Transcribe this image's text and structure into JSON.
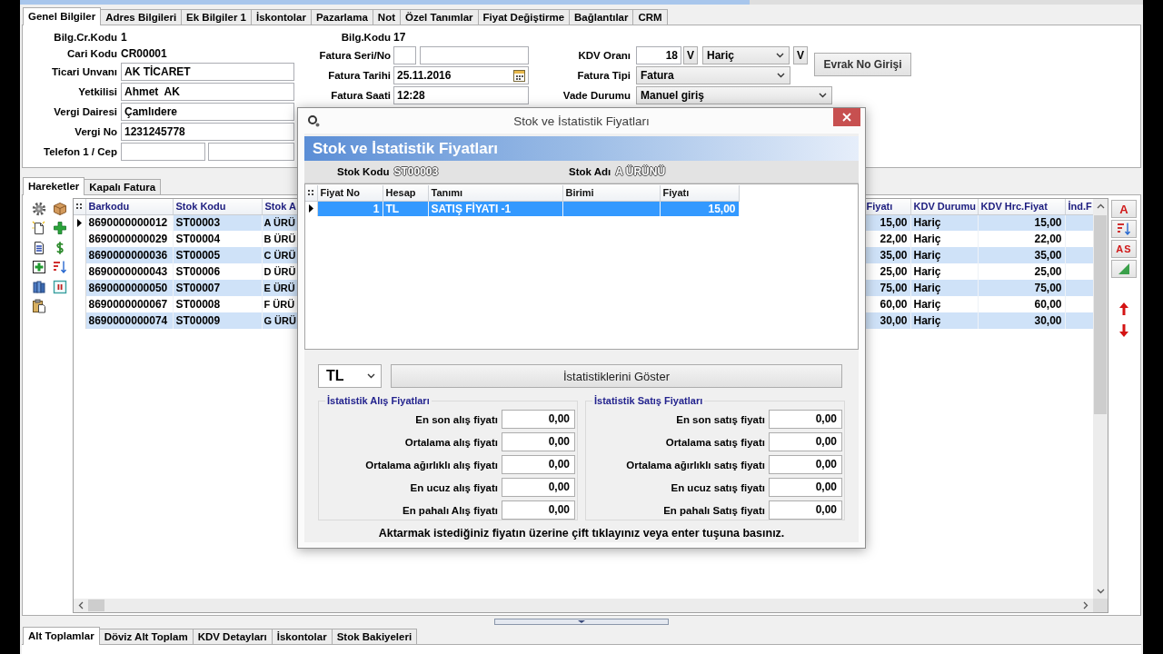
{
  "form_tabs": [
    {
      "label": "Genel Bilgiler",
      "selected": true
    },
    {
      "label": "Adres Bilgileri",
      "selected": false
    },
    {
      "label": "Ek Bilgiler 1",
      "selected": false
    },
    {
      "label": "İskontolar",
      "selected": false
    },
    {
      "label": "Pazarlama",
      "selected": false
    },
    {
      "label": "Not",
      "selected": false
    },
    {
      "label": "Özel Tanımlar",
      "selected": false
    },
    {
      "label": "Fiyat Değiştirme",
      "selected": false
    },
    {
      "label": "Bağlantılar",
      "selected": false
    },
    {
      "label": "CRM",
      "selected": false
    }
  ],
  "customer": [
    {
      "kind": "text",
      "label": "Bilg.Cr.Kodu",
      "value": "1"
    },
    {
      "kind": "text",
      "label": "Cari Kodu",
      "value": "CR00001"
    },
    {
      "kind": "input",
      "label": "Ticari Unvanı",
      "value": "AK TİCARET"
    },
    {
      "kind": "input",
      "label": "Yetkilisi",
      "value": "Ahmet  AK"
    },
    {
      "kind": "input",
      "label": "Vergi Dairesi",
      "value": "Çamlıdere"
    },
    {
      "kind": "input",
      "label": "Vergi No",
      "value": "1231245778"
    },
    {
      "kind": "pair",
      "label": "Telefon 1 / Cep"
    }
  ],
  "invoice": [
    {
      "kind": "text",
      "label": "Bilg.Kodu",
      "value": "17"
    },
    {
      "kind": "pair",
      "label": "Fatura Seri/No"
    },
    {
      "kind": "date",
      "label": "Fatura Tarihi",
      "value": "25.11.2016"
    },
    {
      "kind": "input",
      "label": "Fatura Saati",
      "value": "12:28"
    }
  ],
  "tax": [
    {
      "kind": "rate",
      "label": "KDV Oranı",
      "value": "18",
      "option": "Hariç",
      "buttons": [
        "V",
        "V"
      ]
    },
    {
      "kind": "select",
      "label": "Fatura Tipi",
      "value": "Fatura"
    },
    {
      "kind": "select",
      "label": "Vade Durumu",
      "value": "Manuel giriş"
    }
  ],
  "document_button": "Evrak No Girişi",
  "detail_tabs": [
    {
      "label": "Hareketler",
      "selected": true
    },
    {
      "label": "Kapalı Fatura",
      "selected": false
    }
  ],
  "lines": {
    "columns": [
      "Barkodu",
      "Stok Kodu",
      "Stok A",
      "Fiyatı",
      "KDV Durumu",
      "KDV Hrc.Fiyat",
      "İnd.F"
    ],
    "rows": [
      {
        "selected": true,
        "cells": [
          "8690000000012",
          "ST00003",
          "A ÜRÜ",
          "15,00",
          "Hariç",
          "15,00"
        ]
      },
      {
        "selected": false,
        "cells": [
          "8690000000029",
          "ST00004",
          "B ÜRÜ",
          "22,00",
          "Hariç",
          "22,00"
        ]
      },
      {
        "selected": false,
        "cells": [
          "8690000000036",
          "ST00005",
          "C ÜRÜ",
          "35,00",
          "Hariç",
          "35,00"
        ]
      },
      {
        "selected": false,
        "cells": [
          "8690000000043",
          "ST00006",
          "D ÜRÜ",
          "25,00",
          "Hariç",
          "25,00"
        ]
      },
      {
        "selected": false,
        "cells": [
          "8690000000050",
          "ST00007",
          "E ÜRÜ",
          "75,00",
          "Hariç",
          "75,00"
        ]
      },
      {
        "selected": false,
        "cells": [
          "8690000000067",
          "ST00008",
          "F ÜRÜ",
          "60,00",
          "Hariç",
          "60,00"
        ]
      },
      {
        "selected": false,
        "cells": [
          "8690000000074",
          "ST00009",
          "G ÜRÜ",
          "30,00",
          "Hariç",
          "30,00"
        ]
      }
    ]
  },
  "right_toolbar": [
    "A",
    "AS"
  ],
  "summary_tabs": [
    {
      "label": "Alt Toplamlar",
      "selected": true
    },
    {
      "label": "Döviz Alt Toplam",
      "selected": false
    },
    {
      "label": "KDV Detayları",
      "selected": false
    },
    {
      "label": "İskontolar",
      "selected": false
    },
    {
      "label": "Stok Bakiyeleri",
      "selected": false
    }
  ],
  "price_dialog": {
    "title": "Stok ve İstatistik Fiyatları",
    "heading": "Stok ve İstatistik Fiyatları",
    "stock_code": {
      "label": "Stok Kodu",
      "value": "ST00003"
    },
    "stock_name": {
      "label": "Stok Adı",
      "value": "A ÜRÜNÜ"
    },
    "prices": {
      "columns": [
        "Fiyat No",
        "Hesap",
        "Tanımı",
        "Birimi",
        "Fiyatı"
      ],
      "rows": [
        {
          "selected": true,
          "price_no": "1",
          "account": "TL",
          "description": "SATIŞ FİYATI -1",
          "price": "15,00"
        }
      ]
    },
    "currency": "TL",
    "show_button": "İstatistiklerini Göster",
    "groups": [
      {
        "title": "İstatistik Alış Fiyatları",
        "rows": [
          {
            "label": "En son alış fiyatı",
            "value": "0,00"
          },
          {
            "label": "Ortalama alış fiyatı",
            "value": "0,00"
          },
          {
            "label": "Ortalama ağırlıklı alış fiyatı",
            "value": "0,00"
          },
          {
            "label": "En ucuz alış fiyatı",
            "value": "0,00"
          },
          {
            "label": "En pahalı Alış fiyatı",
            "value": "0,00"
          }
        ]
      },
      {
        "title": "İstatistik Satış Fiyatları",
        "rows": [
          {
            "label": "En son satış fiyatı",
            "value": "0,00"
          },
          {
            "label": "Ortalama satış fiyatı",
            "value": "0,00"
          },
          {
            "label": "Ortalama ağırlıklı satış fiyatı",
            "value": "0,00"
          },
          {
            "label": "En ucuz satış fiyatı",
            "value": "0,00"
          },
          {
            "label": "En pahalı Satış fiyatı",
            "value": "0,00"
          }
        ]
      }
    ],
    "hint": "Aktarmak istediğiniz fiyatın üzerine çift tıklayınız veya enter tuşuna basınız."
  }
}
